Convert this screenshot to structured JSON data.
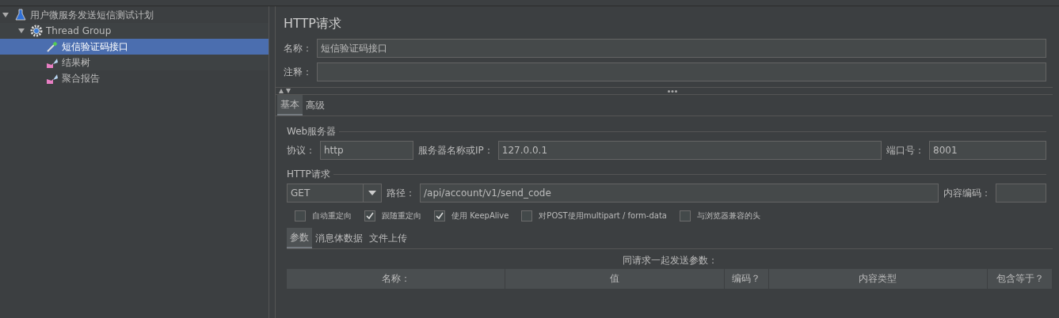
{
  "tree": [
    {
      "label": "用户微服务发送短信测试计划",
      "kind": "plan",
      "expanded": true,
      "selected": false,
      "children": [
        {
          "label": "Thread Group",
          "kind": "group",
          "expanded": true,
          "selected": false,
          "children": [
            {
              "label": "短信验证码接口",
              "kind": "sampler",
              "selected": true
            },
            {
              "label": "结果树",
              "kind": "listener",
              "selected": false
            },
            {
              "label": "聚合报告",
              "kind": "listener",
              "selected": false
            }
          ]
        }
      ]
    }
  ],
  "panel": {
    "title": "HTTP请求",
    "name_field": {
      "label": "名称：",
      "value": "短信验证码接口"
    },
    "comment_field": {
      "label": "注释："
    },
    "tabs": [
      {
        "label": "基本",
        "selected": true
      },
      {
        "label": "高级",
        "selected": false
      }
    ],
    "web_server": {
      "title": "Web服务器",
      "protocol": {
        "label": "协议：",
        "value": "http"
      },
      "server": {
        "label": "服务器名称或IP：",
        "value": "127.0.0.1"
      },
      "port": {
        "label": "端口号：",
        "value": "8001"
      }
    },
    "http_request": {
      "title": "HTTP请求",
      "method": {
        "value": "GET"
      },
      "path": {
        "label": "路径：",
        "value": "/api/account/v1/send_code"
      },
      "encoding": {
        "label": "内容编码："
      }
    },
    "options": [
      {
        "label": "自动重定向",
        "checked": false
      },
      {
        "label": "跟随重定向",
        "checked": true
      },
      {
        "label": "使用 KeepAlive",
        "checked": true
      },
      {
        "label": "对POST使用multipart / form-data",
        "checked": false
      },
      {
        "label": "与浏览器兼容的头",
        "checked": false
      }
    ],
    "param_tabs": [
      {
        "label": "参数",
        "selected": true
      },
      {
        "label": "消息体数据",
        "selected": false
      },
      {
        "label": "文件上传",
        "selected": false
      }
    ],
    "table": {
      "caption": "同请求一起发送参数：",
      "columns": [
        "名称：",
        "值",
        "编码？",
        "内容类型",
        "包含等于？"
      ]
    }
  }
}
